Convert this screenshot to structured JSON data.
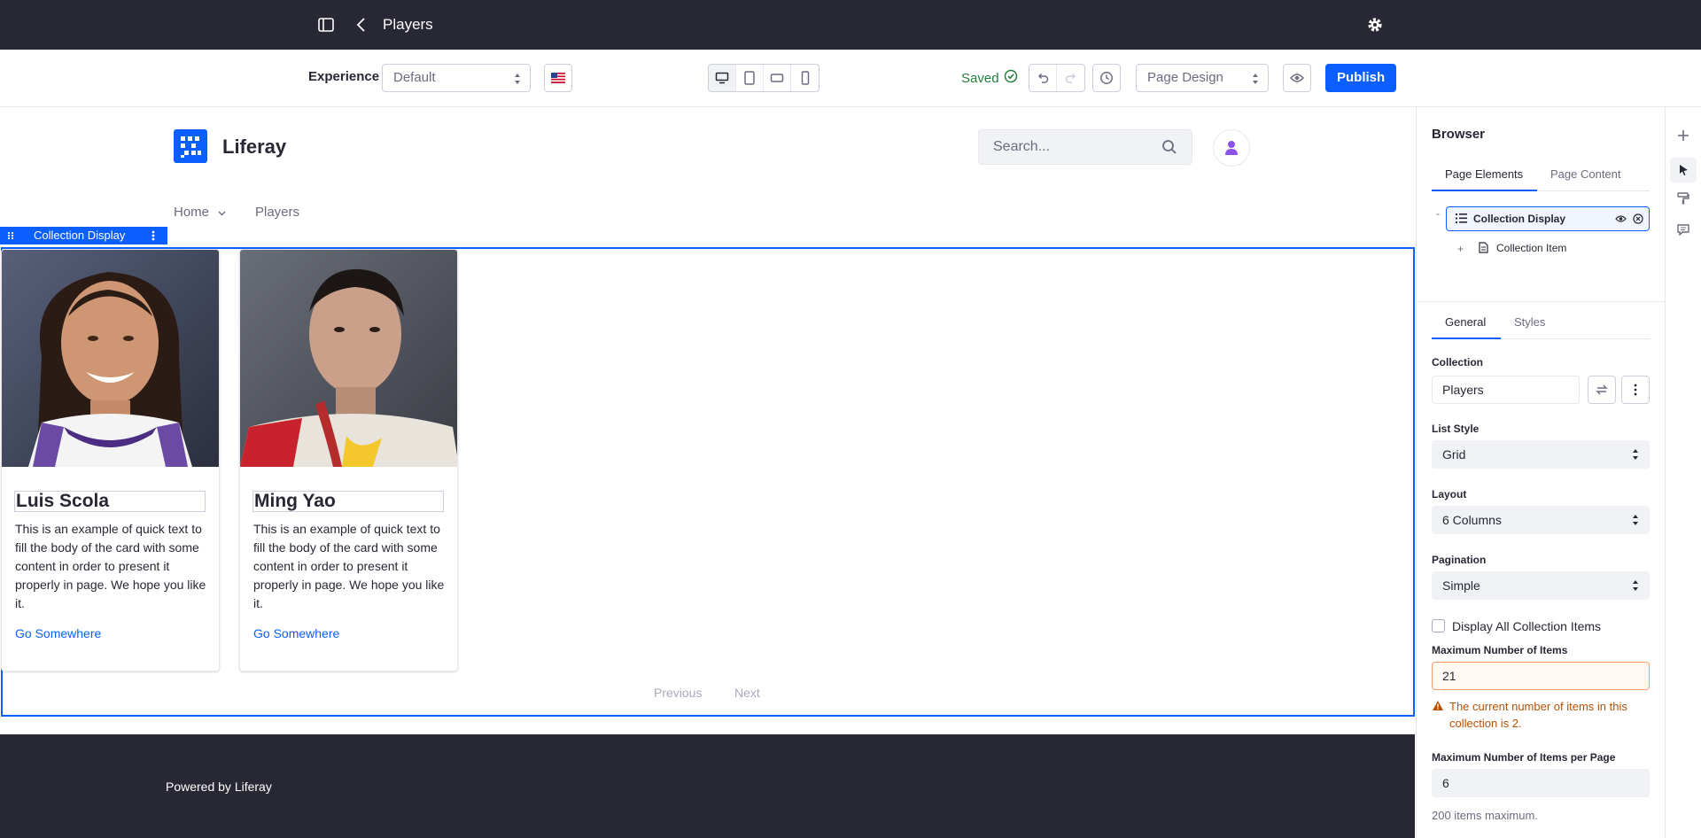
{
  "topbar": {
    "title": "Players",
    "icons": [
      "sidebar-toggle-icon",
      "back-chevron-icon",
      "gear-icon"
    ]
  },
  "toolbar": {
    "experience_label": "Experience",
    "experience_value": "Default",
    "language_flag": "en-US",
    "viewports": [
      "desktop",
      "tablet",
      "landscape-phone",
      "portrait-phone"
    ],
    "saved_label": "Saved",
    "mode_value": "Page Design",
    "publish_label": "Publish"
  },
  "site": {
    "brand": "Liferay",
    "search_placeholder": "Search...",
    "nav": {
      "home": "Home",
      "players": "Players"
    }
  },
  "collection_display": {
    "tag_label": "Collection Display",
    "cards": [
      {
        "name": "Luis Scola",
        "body": "This is an example of quick text to fill the body of the card with some content in order to present it properly in page. We hope you like it.",
        "link": "Go Somewhere"
      },
      {
        "name": "Ming Yao",
        "body": "This is an example of quick text to fill the body of the card with some content in order to present it properly in page. We hope you like it.",
        "link": "Go Somewhere"
      }
    ],
    "pager": {
      "previous": "Previous",
      "next": "Next"
    }
  },
  "footer": {
    "text": "Powered by Liferay"
  },
  "sidebar": {
    "title": "Browser",
    "tabs": {
      "page_elements": "Page Elements",
      "page_content": "Page Content"
    },
    "tree": {
      "root": "Collection Display",
      "root_toggle": "-",
      "child": "Collection Item",
      "child_toggle": "+"
    },
    "config_tabs": {
      "general": "General",
      "styles": "Styles"
    },
    "collection_label": "Collection",
    "collection_value": "Players",
    "list_style_label": "List Style",
    "list_style_value": "Grid",
    "layout_label": "Layout",
    "layout_value": "6 Columns",
    "pagination_label": "Pagination",
    "pagination_value": "Simple",
    "display_all_label": "Display All Collection Items",
    "max_items_label": "Maximum Number of Items",
    "max_items_value": "21",
    "warning_text": "The current number of items in this collection is 2.",
    "max_per_page_label": "Maximum Number of Items per Page",
    "max_per_page_value": "6",
    "max_per_page_help": "200 items maximum."
  },
  "colors": {
    "primary": "#0b5fff",
    "dark": "#272833",
    "success": "#287d3c",
    "warning": "#b95000"
  }
}
